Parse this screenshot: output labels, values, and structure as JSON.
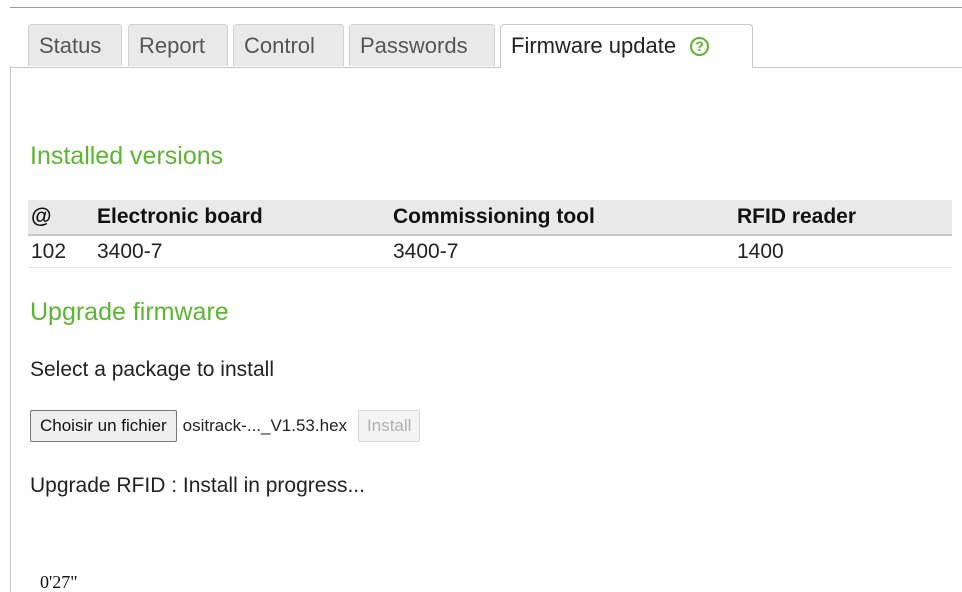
{
  "tabs": [
    {
      "label": "Status",
      "active": false
    },
    {
      "label": "Report",
      "active": false
    },
    {
      "label": "Control",
      "active": false
    },
    {
      "label": "Passwords",
      "active": false
    },
    {
      "label": "Firmware update",
      "active": true
    }
  ],
  "help_icon": {
    "glyph": "?",
    "icon": "help-circle-icon",
    "color": "#5cb531"
  },
  "installed": {
    "title": "Installed versions",
    "columns": [
      "@",
      "Electronic board",
      "Commissioning tool",
      "RFID reader"
    ],
    "rows": [
      [
        "102",
        "3400-7",
        "3400-7",
        "1400"
      ]
    ]
  },
  "upgrade": {
    "title": "Upgrade firmware",
    "instruction": "Select a package to install",
    "choose_label": "Choisir un fichier",
    "file_name": "ositrack-..._V1.53.hex",
    "install_label": "Install",
    "progress_text": "Upgrade RFID : Install in progress...",
    "timer": "0'27\""
  },
  "colors": {
    "accent": "#5cb531",
    "tab_background": "#e9e9e9",
    "header_background": "#e9e9e9"
  }
}
